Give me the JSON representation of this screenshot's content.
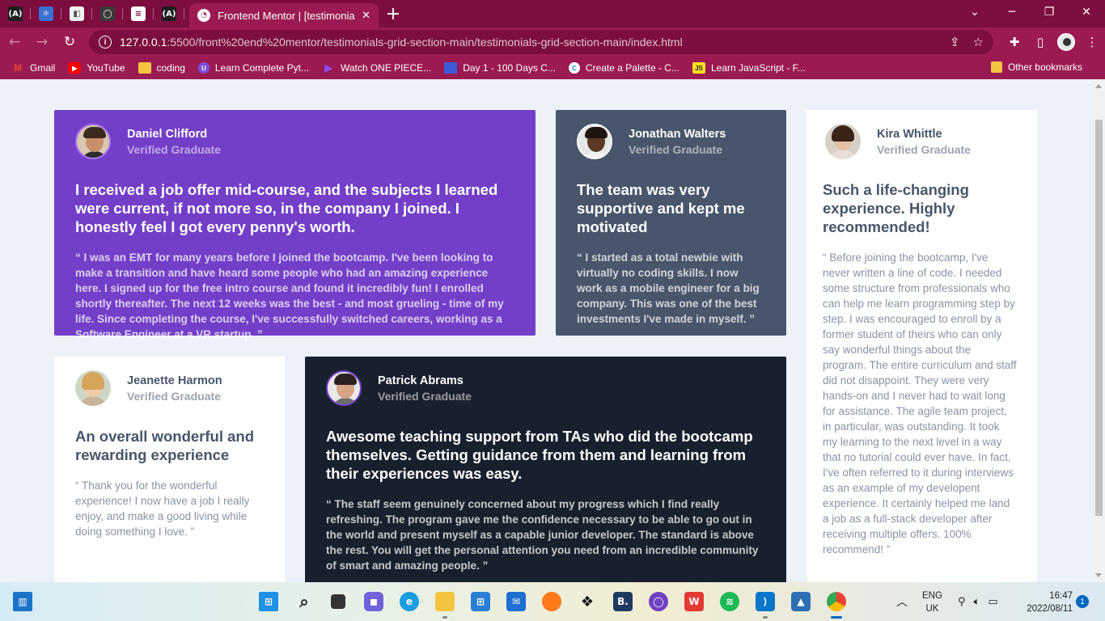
{
  "browser": {
    "pinned_tabs": [
      {
        "name": "angular",
        "glyph": "(A)",
        "color": "#1e1e1e"
      },
      {
        "name": "react",
        "glyph": "⚛",
        "color": "#3b6fd1"
      },
      {
        "name": "docs",
        "glyph": "◧",
        "color": "#f2f2f2"
      },
      {
        "name": "github",
        "glyph": "◯",
        "color": "#3a3a3a"
      },
      {
        "name": "stack",
        "glyph": "≡",
        "color": "#7c0d3e"
      },
      {
        "name": "angular2",
        "glyph": "(A)",
        "color": "#1e1e1e"
      }
    ],
    "active_tab_title": "Frontend Mentor | [testimonials-g",
    "new_tab": "+",
    "url_host": "127.0.0.1",
    "url_path": ":5500/front%20end%20mentor/testimonials-grid-section-main/testimonials-grid-section-main/index.html",
    "bookmarks": [
      {
        "label": "Gmail",
        "icon_color": "#ea4335",
        "glyph": "M"
      },
      {
        "label": "YouTube",
        "icon_color": "#ff0000",
        "glyph": "▶"
      },
      {
        "label": "coding",
        "icon_color": "#f5c542",
        "glyph": ""
      },
      {
        "label": "Learn Complete Pyt...",
        "icon_color": "#7d4cdb",
        "glyph": "U"
      },
      {
        "label": "Watch ONE PIECE...",
        "icon_color": "#8a4fff",
        "glyph": "▶"
      },
      {
        "label": "Day 1 - 100 Days C...",
        "icon_color": "#3b5bdb",
        "glyph": ""
      },
      {
        "label": "Create a Palette - C...",
        "icon_color": "#1e88e5",
        "glyph": "C"
      },
      {
        "label": "Learn JavaScript - F...",
        "icon_color": "#f7df1e",
        "glyph": "JS"
      }
    ],
    "other_bookmarks": "Other bookmarks"
  },
  "testimonials": {
    "daniel": {
      "name": "Daniel Clifford",
      "role": "Verified Graduate",
      "headline": "I received a job offer mid-course, and the subjects I learned were current, if not more so, in the company I joined. I honestly feel I got every penny's worth.",
      "quote": "“ I was an EMT for many years before I joined the bootcamp. I've been looking to make a transition and have heard some people who had an amazing experience here. I signed up for the free intro course and found it incredibly fun! I enrolled shortly thereafter. The next 12 weeks was the best - and most grueling - time of my life. Since completing the course, I've successfully switched careers, working as a Software Engineer at a VR startup. ”"
    },
    "jonathan": {
      "name": "Jonathan Walters",
      "role": "Verified Graduate",
      "headline": "The team was very supportive and kept me motivated",
      "quote": "“ I started as a total newbie with virtually no coding skills. I now work as a mobile engineer for a big company. This was one of the best investments I've made in myself. ”"
    },
    "kira": {
      "name": "Kira Whittle",
      "role": "Verified Graduate",
      "headline": "Such a life-changing experience. Highly recommended!",
      "quote": "“ Before joining the bootcamp, I've never written a line of code. I needed some structure from professionals who can help me learn programming step by step. I was encouraged to enroll by a former student of theirs who can only say wonderful things about the program. The entire curriculum and staff did not disappoint. They were very hands-on and I never had to wait long for assistance. The agile team project, in particular, was outstanding. It took my learning to the next level in a way that no tutorial could ever have. In fact, I've often referred to it during interviews as an example of my developent experience. It certainly helped me land a job as a full-stack developer after receiving multiple offers. 100% recommend! ”"
    },
    "jeanette": {
      "name": "Jeanette Harmon",
      "role": "Verified Graduate",
      "headline": "An overall wonderful and rewarding experience",
      "quote": "“ Thank you for the wonderful experience! I now have a job I really enjoy, and make a good living while doing something I love. ”"
    },
    "patrick": {
      "name": "Patrick Abrams",
      "role": "Verified Graduate",
      "headline": "Awesome teaching support from TAs who did the bootcamp themselves. Getting guidance from them and learning from their experiences was easy.",
      "quote": "“ The staff seem genuinely concerned about my progress which I find really refreshing. The program gave me the confidence necessary to be able to go out in the world and present myself as a capable junior developer. The standard is above the rest. You will get the personal attention you need from an incredible community of smart and amazing people. ”"
    }
  },
  "taskbar": {
    "lang_top": "ENG",
    "lang_bottom": "UK",
    "time": "16:47",
    "date": "2022/08/11",
    "notifications": "1"
  },
  "colors": {
    "violet": "#733fc8",
    "grayish_blue": "#48556a",
    "blackish_blue": "#19202d",
    "page_bg": "#ecf2f8",
    "chrome": "#9c1a52"
  }
}
